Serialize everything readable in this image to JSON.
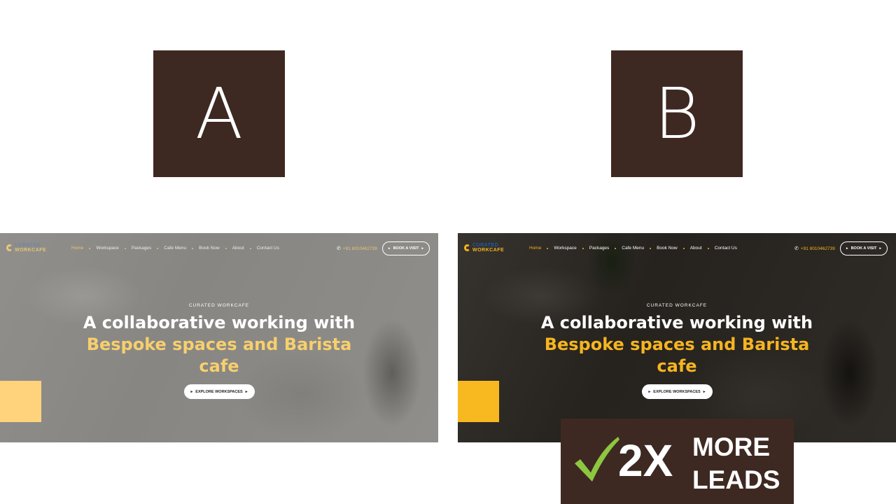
{
  "variants": [
    {
      "label": "A",
      "mockup": {
        "logo": {
          "top": "CURATED",
          "bottom": "WORKCAFE"
        },
        "nav": [
          "Home",
          "Workspace",
          "Packages",
          "Cafe Menu",
          "Book Now",
          "About",
          "Contact Us"
        ],
        "phone": "+91 8010462739",
        "cta": "BOOK A VISIT",
        "eyebrow": "CURATED WORKCAFE",
        "headline_white": "A collaborative working with",
        "headline_accent": "Bespoke spaces and Barista",
        "headline_end": "cafe",
        "button": "EXPLORE WORKSPACES",
        "accent_color": "#f7cf6d",
        "overlay": "light grey"
      }
    },
    {
      "label": "B",
      "mockup": {
        "logo": {
          "top": "CURATED",
          "bottom": "WORKCAFE"
        },
        "nav": [
          "Home",
          "Workspace",
          "Packages",
          "Cafe Menu",
          "Book Now",
          "About",
          "Contact Us"
        ],
        "phone": "+91 8010462739",
        "cta": "BOOK A VISIT",
        "eyebrow": "CURATED WORKCAFE",
        "headline_white": "A collaborative working with",
        "headline_accent": "Bespoke spaces and Barista",
        "headline_end": "cafe",
        "button": "EXPLORE WORKSPACES",
        "accent_color": "#f6b520",
        "overlay": "dark"
      }
    }
  ],
  "result_badge": {
    "icon": "checkmark-icon",
    "big_text": "2X",
    "line1": "MORE",
    "line2": "LEADS",
    "background": "#3e2922",
    "check_color": "#8dc63f"
  },
  "colors": {
    "label_box": "#3e2922",
    "brand_yellow": "#f6b520"
  }
}
